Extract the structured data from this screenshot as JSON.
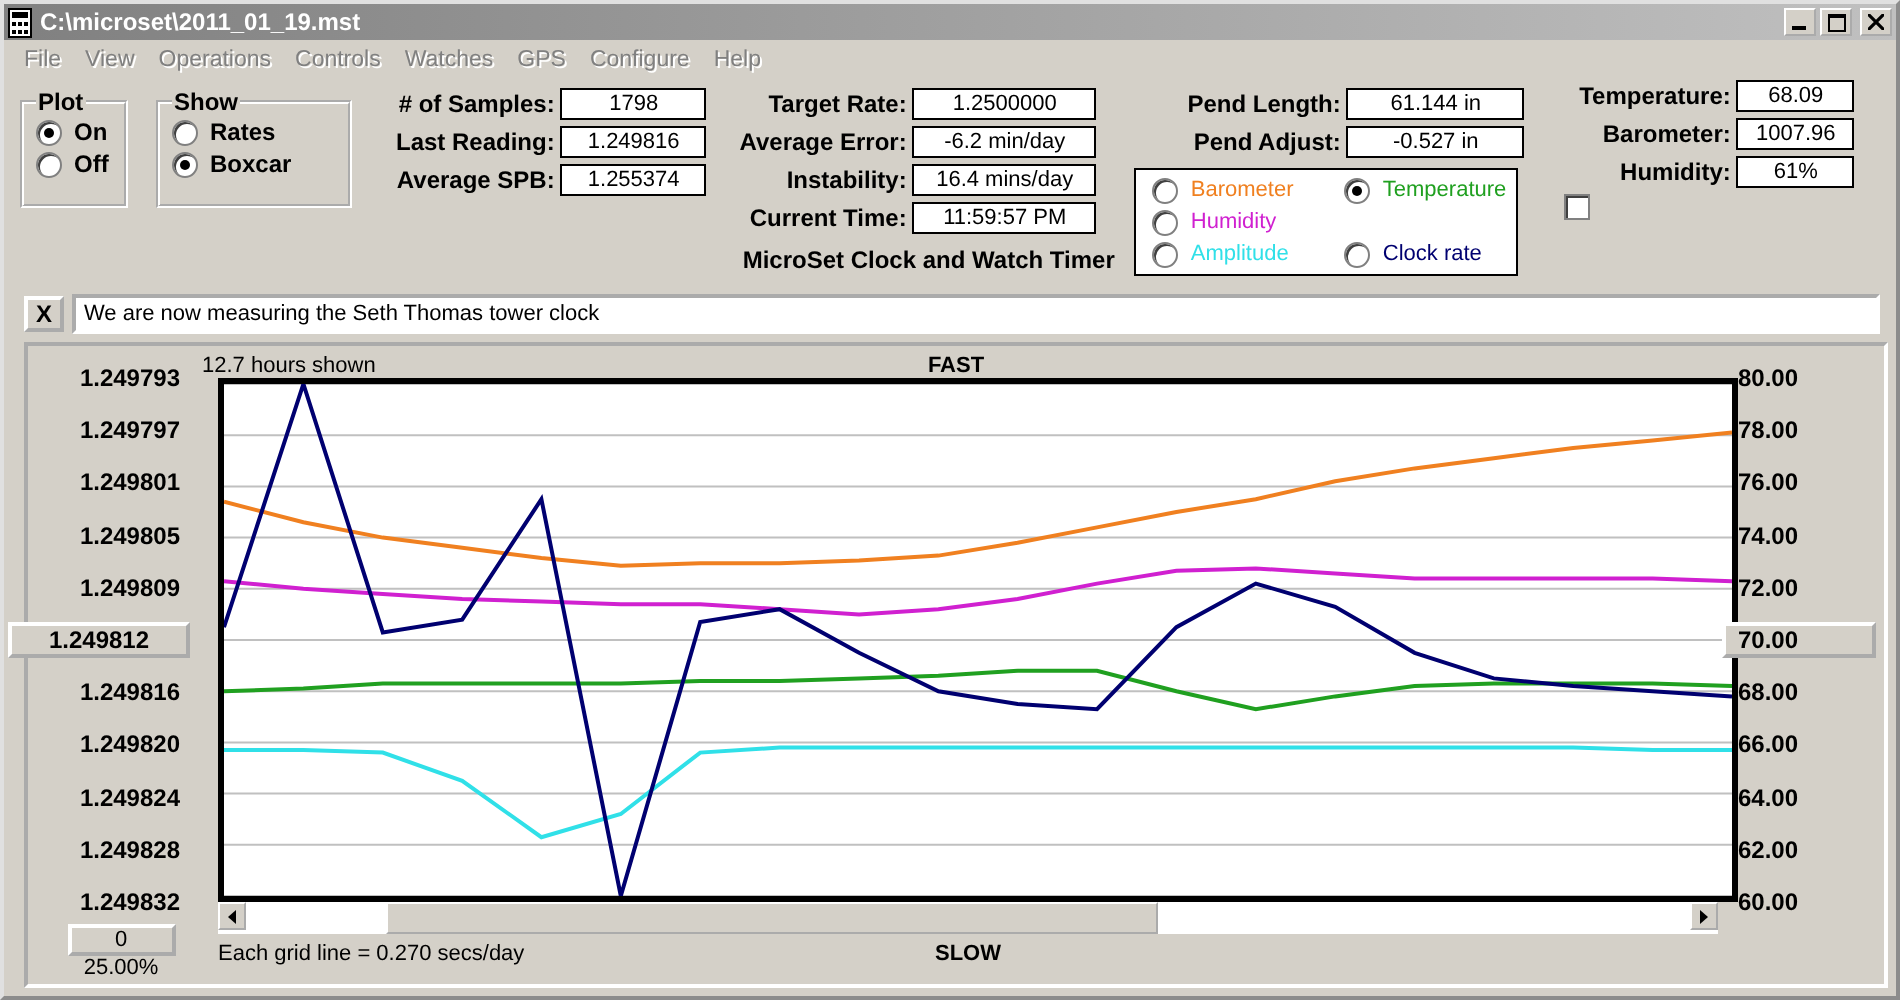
{
  "window": {
    "title": "C:\\microset\\2011_01_19.mst"
  },
  "menu": [
    {
      "label": "File",
      "disabled": true
    },
    {
      "label": "View",
      "disabled": true
    },
    {
      "label": "Operations",
      "disabled": true
    },
    {
      "label": "Controls",
      "disabled": true
    },
    {
      "label": "Watches",
      "disabled": true
    },
    {
      "label": "GPS",
      "disabled": true
    },
    {
      "label": "Configure",
      "disabled": true
    },
    {
      "label": "Help",
      "disabled": true
    }
  ],
  "plot_group": {
    "title": "Plot",
    "options": [
      {
        "label": "On",
        "selected": true
      },
      {
        "label": "Off",
        "selected": false
      }
    ]
  },
  "show_group": {
    "title": "Show",
    "options": [
      {
        "label": "Rates",
        "selected": false
      },
      {
        "label": "Boxcar",
        "selected": true
      }
    ]
  },
  "stats": [
    {
      "label": "# of Samples:",
      "value": "1798"
    },
    {
      "label": "Last Reading:",
      "value": "1.249816"
    },
    {
      "label": "Average SPB:",
      "value": "1.255374"
    }
  ],
  "rates": [
    {
      "label": "Target Rate:",
      "value": "1.2500000"
    },
    {
      "label": "Average Error:",
      "value": "-6.2 min/day"
    },
    {
      "label": "Instability:",
      "value": "16.4 mins/day"
    },
    {
      "label": "Current Time:",
      "value": "11:59:57 PM"
    }
  ],
  "caption": "MicroSet Clock and Watch Timer",
  "pendulum": [
    {
      "label": "Pend Length:",
      "value": "61.144 in"
    },
    {
      "label": "Pend Adjust:",
      "value": "-0.527 in"
    }
  ],
  "legend": [
    {
      "label": "Barometer",
      "color": "#f08020",
      "selected": false
    },
    {
      "label": "Temperature",
      "color": "#20a020",
      "selected": true
    },
    {
      "label": "Humidity",
      "color": "#d020d0",
      "selected": false
    },
    {
      "label": "Amplitude",
      "color": "#30e0e8",
      "selected": false
    },
    {
      "label": "Clock rate",
      "color": "#000070",
      "selected": false
    }
  ],
  "sensors": [
    {
      "label": "Temperature:",
      "value": "68.09"
    },
    {
      "label": "Barometer:",
      "value": "1007.96"
    },
    {
      "label": "Humidity:",
      "value": "61%"
    }
  ],
  "sensor_checkbox": {
    "checked": false
  },
  "message": {
    "close": "X",
    "value": "We are now measuring the Seth Thomas tower clock"
  },
  "plot": {
    "hours_label": "12.7 hours shown",
    "top_label": "FAST",
    "bottom_label": "SLOW",
    "grid_note": "Each grid line = 0.270 secs/day",
    "offset_button": "0",
    "zoom_label": "25.00%",
    "left_axis": [
      {
        "label": "1.249793",
        "kind": "text"
      },
      {
        "label": "1.249797",
        "kind": "text"
      },
      {
        "label": "1.249801",
        "kind": "text"
      },
      {
        "label": "1.249805",
        "kind": "text"
      },
      {
        "label": "1.249809",
        "kind": "text"
      },
      {
        "label": "1.249812",
        "kind": "button"
      },
      {
        "label": "1.249816",
        "kind": "text"
      },
      {
        "label": "1.249820",
        "kind": "text"
      },
      {
        "label": "1.249824",
        "kind": "text"
      },
      {
        "label": "1.249828",
        "kind": "text"
      },
      {
        "label": "1.249832",
        "kind": "text"
      }
    ],
    "chart_data": {
      "type": "line",
      "ylim": [
        60,
        80
      ],
      "grid": true,
      "yticks": [
        {
          "value": 80,
          "label": "80.00"
        },
        {
          "value": 78,
          "label": "78.00"
        },
        {
          "value": 76,
          "label": "76.00"
        },
        {
          "value": 74,
          "label": "74.00"
        },
        {
          "value": 72,
          "label": "72.00"
        },
        {
          "value": 70,
          "label": "70.00"
        },
        {
          "value": 68,
          "label": "68.00"
        },
        {
          "value": 66,
          "label": "66.00"
        },
        {
          "value": 64,
          "label": "64.00"
        },
        {
          "value": 62,
          "label": "62.00"
        },
        {
          "value": 60,
          "label": "60.00"
        }
      ],
      "series": [
        {
          "color": "#f08020",
          "values": [
            75.4,
            74.6,
            74.0,
            73.6,
            73.2,
            72.9,
            73.0,
            73.0,
            73.1,
            73.3,
            73.8,
            74.4,
            75.0,
            75.5,
            76.2,
            76.7,
            77.1,
            77.5,
            77.8,
            78.1
          ]
        },
        {
          "color": "#d020d0",
          "values": [
            72.3,
            72.0,
            71.8,
            71.6,
            71.5,
            71.4,
            71.4,
            71.2,
            71.0,
            71.2,
            71.6,
            72.2,
            72.7,
            72.8,
            72.6,
            72.4,
            72.4,
            72.4,
            72.4,
            72.3
          ]
        },
        {
          "color": "#20a020",
          "values": [
            68.0,
            68.1,
            68.3,
            68.3,
            68.3,
            68.3,
            68.4,
            68.4,
            68.5,
            68.6,
            68.8,
            68.8,
            68.0,
            67.3,
            67.8,
            68.2,
            68.3,
            68.3,
            68.3,
            68.2
          ]
        },
        {
          "color": "#30e0e8",
          "values": [
            65.7,
            65.7,
            65.6,
            64.5,
            62.3,
            63.2,
            65.6,
            65.8,
            65.8,
            65.8,
            65.8,
            65.8,
            65.8,
            65.8,
            65.8,
            65.8,
            65.8,
            65.8,
            65.7,
            65.7
          ]
        },
        {
          "color": "#000070",
          "values": [
            70.5,
            80.0,
            70.3,
            70.8,
            75.5,
            60.0,
            70.7,
            71.2,
            69.5,
            68.0,
            67.5,
            67.3,
            70.5,
            72.2,
            71.3,
            69.5,
            68.5,
            68.2,
            68.0,
            67.8
          ]
        }
      ]
    }
  }
}
